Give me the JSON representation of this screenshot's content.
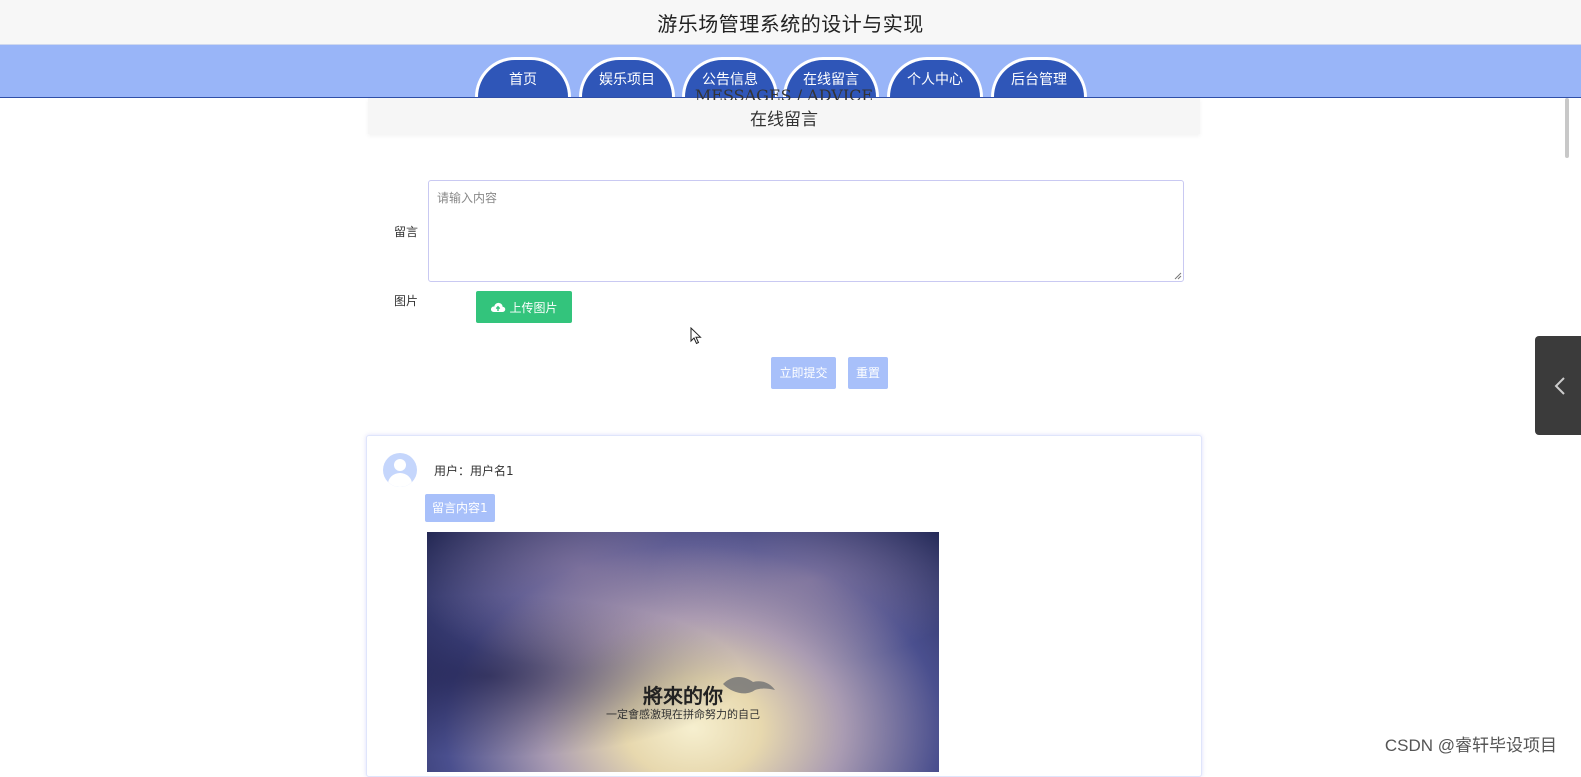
{
  "header": {
    "title": "游乐场管理系统的设计与实现"
  },
  "nav": {
    "items": [
      {
        "label": "首页"
      },
      {
        "label": "娱乐项目"
      },
      {
        "label": "公告信息"
      },
      {
        "label": "在线留言"
      },
      {
        "label": "个人中心"
      },
      {
        "label": "后台管理"
      }
    ]
  },
  "section": {
    "title_en": "MESSAGES / ADVICE",
    "title_cn": "在线留言"
  },
  "form": {
    "message_label": "留言",
    "message_placeholder": "请输入内容",
    "image_label": "图片",
    "upload_label": "上传图片",
    "submit_label": "立即提交",
    "reset_label": "重置"
  },
  "comment": {
    "user_line": "用户：用户名1",
    "content": "留言内容1",
    "image_text_main": "將來的你",
    "image_text_sub": "一定會感激現在拼命努力的自己"
  },
  "watermark": "CSDN @睿轩毕设项目",
  "colors": {
    "nav_bg": "#99b5f8",
    "tab_bg": "#2f56b8",
    "upload_btn": "#33c47c",
    "light_btn": "#a8c0fa"
  }
}
